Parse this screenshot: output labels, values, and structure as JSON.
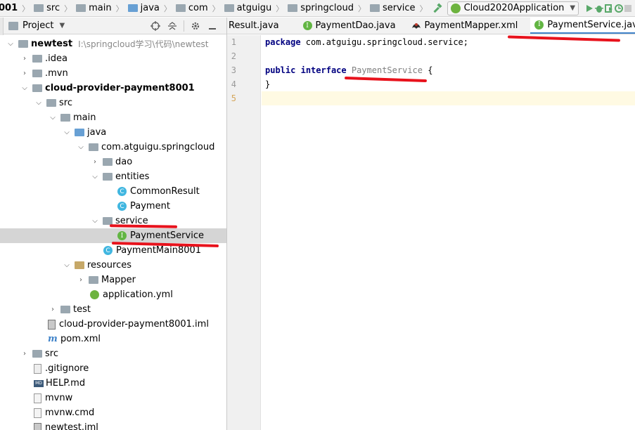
{
  "navbar": {
    "crumbs": [
      "001",
      "src",
      "main",
      "java",
      "com",
      "atguigu",
      "springcloud",
      "service"
    ],
    "run_config": "Cloud2020Application"
  },
  "project_panel": {
    "title": "Project"
  },
  "tabs": [
    {
      "label": "Result.java",
      "icon": "class-icon"
    },
    {
      "label": "PaymentDao.java",
      "icon": "interface-icon"
    },
    {
      "label": "PaymentMapper.xml",
      "icon": "mybatis-icon"
    },
    {
      "label": "PaymentService.java",
      "icon": "interface-icon",
      "active": true
    }
  ],
  "tree": [
    {
      "label": "newtest",
      "path": "I:\\springcloud学习\\代码\\newtest",
      "bold": true
    },
    {
      "label": ".idea"
    },
    {
      "label": ".mvn"
    },
    {
      "label": "cloud-provider-payment8001",
      "bold": true
    },
    {
      "label": "src"
    },
    {
      "label": "main"
    },
    {
      "label": "java"
    },
    {
      "label": "com.atguigu.springcloud"
    },
    {
      "label": "dao"
    },
    {
      "label": "entities"
    },
    {
      "label": "CommonResult"
    },
    {
      "label": "Payment"
    },
    {
      "label": "service"
    },
    {
      "label": "PaymentService"
    },
    {
      "label": "PaymentMain8001"
    },
    {
      "label": "resources"
    },
    {
      "label": "Mapper"
    },
    {
      "label": "application.yml"
    },
    {
      "label": "test"
    },
    {
      "label": "cloud-provider-payment8001.iml"
    },
    {
      "label": "pom.xml"
    },
    {
      "label": "src"
    },
    {
      "label": ".gitignore"
    },
    {
      "label": "HELP.md"
    },
    {
      "label": "mvnw"
    },
    {
      "label": "mvnw.cmd"
    },
    {
      "label": "newtest.iml"
    }
  ],
  "editor": {
    "line_numbers": [
      "1",
      "2",
      "3",
      "4",
      "5"
    ],
    "line1_kw": "package",
    "line1_rest": " com.atguigu.springcloud.service;",
    "line3_kw1": "public",
    "line3_kw2": "interface",
    "line3_name": "PaymentService",
    "line3_brace": " {",
    "line4": "}"
  },
  "colors": {
    "annotation": "#e8121c",
    "keyword": "#000080",
    "selection": "#d5d5d5"
  }
}
